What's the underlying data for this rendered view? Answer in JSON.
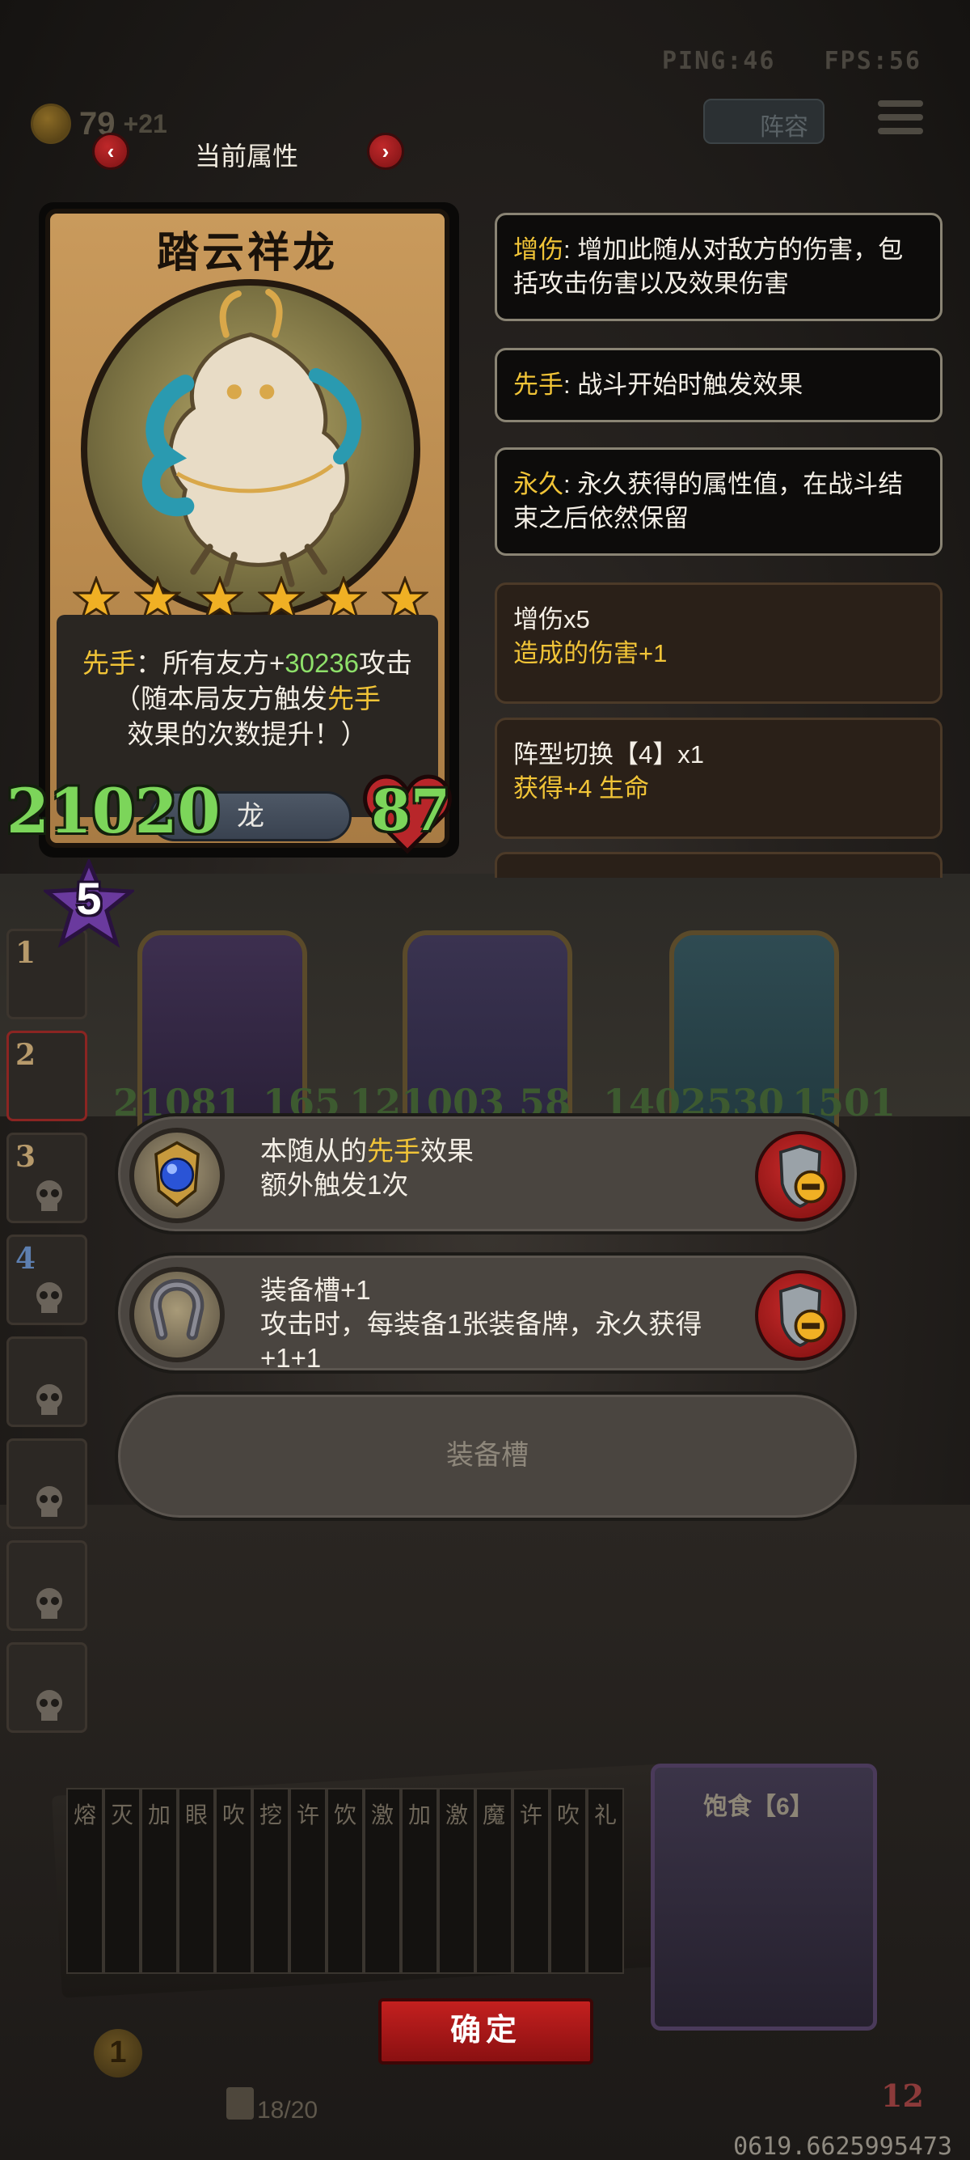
{
  "hud": {
    "ping": "PING:46",
    "fps": "FPS:56",
    "gold": "79",
    "gold_plus": "+21",
    "lineup_label": "阵容",
    "tier": "5"
  },
  "header": {
    "title": "当前属性",
    "prev_arrow": "‹",
    "next_arrow": "›"
  },
  "unit_card": {
    "name": "踏云祥龙",
    "stars": 6,
    "desc": {
      "kw": "先手",
      "p1": "：所有友方+",
      "value": "30236",
      "p2": "攻击",
      "p3": "（随本局友方触发",
      "kw2": "先手",
      "p4": "效果的次数提升！）"
    },
    "race": "龙",
    "attack": "21020",
    "hp": "87"
  },
  "attributes": [
    {
      "kw": "增伤",
      "text": ": 增加此随从对敌方的伤害，包括攻击伤害以及效果伤害"
    },
    {
      "kw": "先手",
      "text": ": 战斗开始时触发效果"
    },
    {
      "kw": "永久",
      "text": ": 永久获得的属性值，在战斗结束之后依然保留"
    }
  ],
  "buffs": [
    {
      "title": "增伤x5",
      "sub": "造成的伤害+1"
    },
    {
      "title": "阵型切换【4】x1",
      "sub": "获得+4 生命"
    }
  ],
  "lineup_slots": [
    "1",
    "2",
    "3",
    "4"
  ],
  "board_stats": [
    "21081",
    "165",
    "121003",
    "58",
    "1402530",
    "1501"
  ],
  "equipment": [
    {
      "line1_pre": "本随从的",
      "kw": "先手",
      "line1_post": "效果",
      "line2": "额外触发1次"
    },
    {
      "line1": "装备槽+1",
      "line2": "攻击时，每装备1张装备牌，永久获得+1+1"
    }
  ],
  "empty_slot_label": "装备槽",
  "hand": {
    "cards": [
      "熔",
      "灭",
      "加",
      "眼",
      "吹",
      "挖",
      "许",
      "饮",
      "激",
      "加",
      "激",
      "魔",
      "许",
      "吹",
      "礼"
    ],
    "big_card_title": "饱食【6】",
    "deck_count": "18/20",
    "coin": "1",
    "hp": "12"
  },
  "confirm_label": "确定",
  "footer_id": "0619.6625995473",
  "colors": {
    "keyword": "#f1c437",
    "value_green": "#8ee06a",
    "stat_green": "#7cd55a",
    "confirm_red": "#c4201f"
  }
}
